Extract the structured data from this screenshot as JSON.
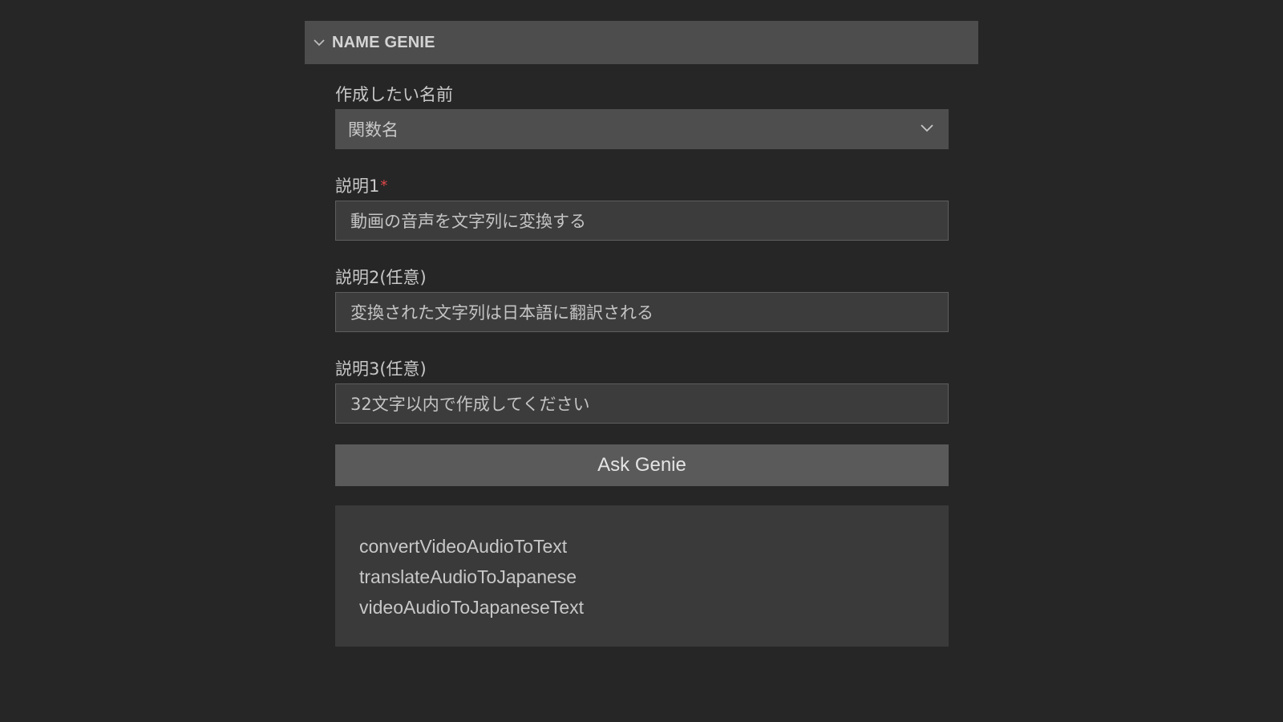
{
  "panel": {
    "title": "NAME GENIE",
    "icon": "chevron-down-icon"
  },
  "form": {
    "name_type": {
      "label": "作成したい名前",
      "selected": "関数名",
      "icon": "chevron-down-icon"
    },
    "description1": {
      "label": "説明1",
      "required_mark": "*",
      "value": "動画の音声を文字列に変換する"
    },
    "description2": {
      "label": "説明2(任意)",
      "value": "変換された文字列は日本語に翻訳される"
    },
    "description3": {
      "label": "説明3(任意)",
      "value": "32文字以内で作成してください"
    },
    "ask_button_label": "Ask Genie"
  },
  "results": [
    "convertVideoAudioToText",
    "translateAudioToJapanese",
    "videoAudioToJapaneseText"
  ],
  "colors": {
    "background": "#262626",
    "header": "#4d4d4d",
    "required": "#e04848"
  }
}
